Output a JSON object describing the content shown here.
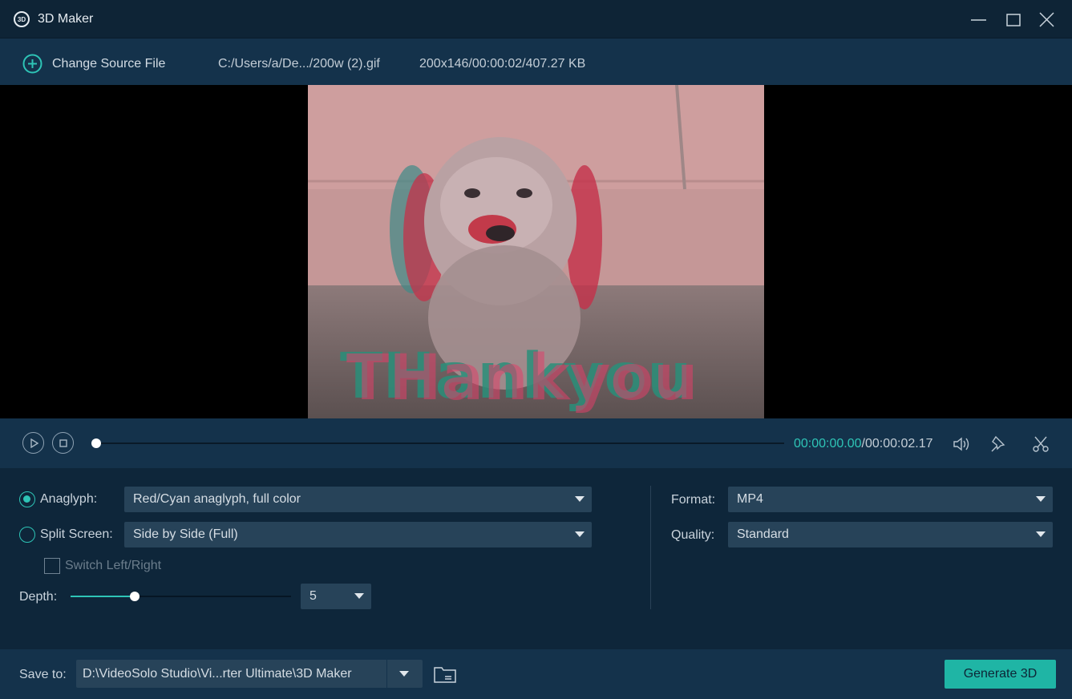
{
  "window": {
    "title": "3D Maker",
    "logo_text": "3D"
  },
  "toolbar": {
    "change_source_label": "Change Source File",
    "source_path": "C:/Users/a/De.../200w (2).gif",
    "source_info": "200x146/00:00:02/407.27 KB"
  },
  "preview": {
    "frame_text": "THankyou"
  },
  "playback": {
    "current_time": "00:00:00.00",
    "separator": "/",
    "total_time": "00:00:02.17",
    "progress": 0
  },
  "settings": {
    "anaglyph": {
      "label": "Anaglyph:",
      "value": "Red/Cyan anaglyph, full color",
      "selected": true
    },
    "split_screen": {
      "label": "Split Screen:",
      "value": "Side by Side (Full)",
      "selected": false
    },
    "switch_lr": {
      "label": "Switch Left/Right",
      "checked": false,
      "enabled": false
    },
    "depth": {
      "label": "Depth:",
      "value": "5",
      "slider_fraction": 0.29
    },
    "format": {
      "label": "Format:",
      "value": "MP4"
    },
    "quality": {
      "label": "Quality:",
      "value": "Standard"
    }
  },
  "bottom": {
    "save_label": "Save to:",
    "save_path": "D:\\VideoSolo Studio\\Vi...rter Ultimate\\3D Maker",
    "generate_label": "Generate 3D"
  },
  "colors": {
    "accent": "#2ec4b6",
    "panel": "#14324b",
    "background": "#0c2235",
    "dropdown": "#274359"
  },
  "icons": [
    "app-logo-icon",
    "minimize-icon",
    "maximize-icon",
    "close-icon",
    "add-circle-icon",
    "play-icon",
    "stop-icon",
    "volume-icon",
    "pin-icon",
    "scissors-icon",
    "folder-icon",
    "caret-down-icon"
  ]
}
